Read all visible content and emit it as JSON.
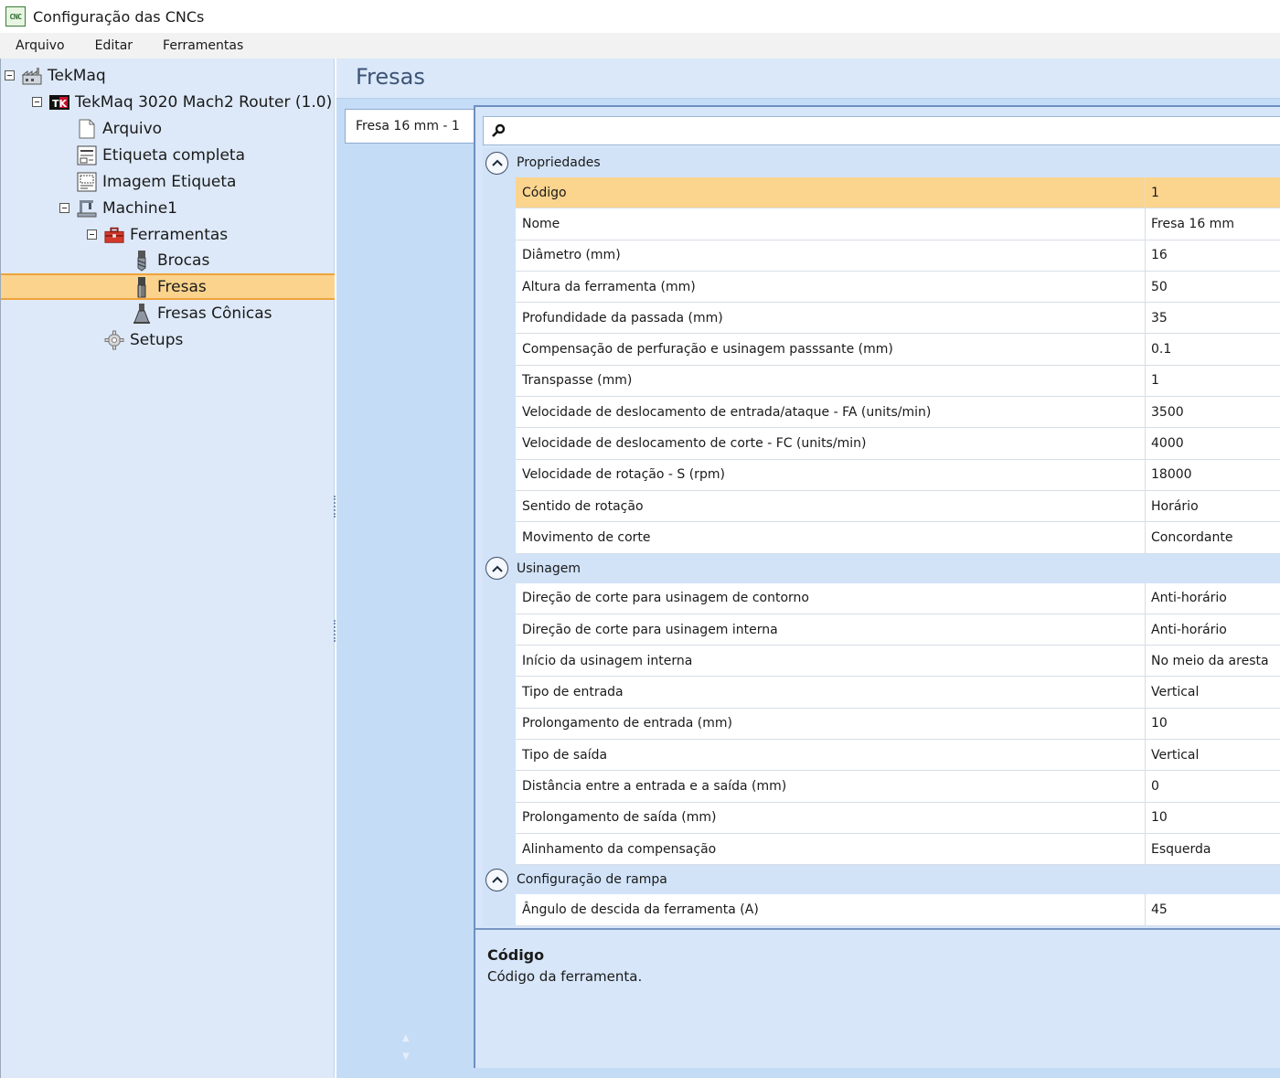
{
  "window": {
    "title": "Configuração das CNCs",
    "app_icon_text": "CNC"
  },
  "menu": [
    "Arquivo",
    "Editar",
    "Ferramentas"
  ],
  "tree": [
    {
      "label": "TekMaq",
      "level": 0,
      "toggle": true,
      "icon": "factory-icon"
    },
    {
      "label": "TekMaq 3020 Mach2 Router (1.0)",
      "level": 1,
      "toggle": true,
      "icon": "tk-logo-icon"
    },
    {
      "label": "Arquivo",
      "level": 2,
      "toggle": false,
      "icon": "file-icon"
    },
    {
      "label": "Etiqueta completa",
      "level": 2,
      "toggle": false,
      "icon": "label-icon"
    },
    {
      "label": "Imagem Etiqueta",
      "level": 2,
      "toggle": false,
      "icon": "label-image-icon"
    },
    {
      "label": "Machine1",
      "level": 2,
      "toggle": true,
      "icon": "machine-icon"
    },
    {
      "label": "Ferramentas",
      "level": 3,
      "toggle": true,
      "icon": "toolbox-icon"
    },
    {
      "label": "Brocas",
      "level": 4,
      "toggle": false,
      "icon": "drill-bit-icon"
    },
    {
      "label": "Fresas",
      "level": 4,
      "toggle": false,
      "icon": "end-mill-icon",
      "selected": true
    },
    {
      "label": "Fresas Cônicas",
      "level": 4,
      "toggle": false,
      "icon": "conical-mill-icon"
    },
    {
      "label": "Setups",
      "level": 3,
      "toggle": false,
      "icon": "gear-icon"
    }
  ],
  "pane": {
    "title": "Fresas",
    "tab": "Fresa 16 mm - 1"
  },
  "categories": [
    {
      "name": "Propriedades",
      "props": [
        {
          "name": "Código",
          "value": "1",
          "selected": true
        },
        {
          "name": "Nome",
          "value": "Fresa 16 mm"
        },
        {
          "name": "Diâmetro (mm)",
          "value": "16"
        },
        {
          "name": "Altura da ferramenta (mm)",
          "value": "50"
        },
        {
          "name": "Profundidade da passada (mm)",
          "value": "35"
        },
        {
          "name": "Compensação de perfuração e usinagem passsante (mm)",
          "value": "0.1"
        },
        {
          "name": "Transpasse (mm)",
          "value": "1"
        },
        {
          "name": "Velocidade de deslocamento de entrada/ataque - FA (units/min)",
          "value": "3500"
        },
        {
          "name": "Velocidade de deslocamento de corte - FC (units/min)",
          "value": "4000"
        },
        {
          "name": "Velocidade de rotação - S (rpm)",
          "value": "18000"
        },
        {
          "name": "Sentido de rotação",
          "value": "Horário"
        },
        {
          "name": "Movimento de corte",
          "value": "Concordante"
        }
      ]
    },
    {
      "name": "Usinagem",
      "props": [
        {
          "name": "Direção de corte para usinagem de contorno",
          "value": "Anti-horário"
        },
        {
          "name": "Direção de corte para usinagem interna",
          "value": "Anti-horário"
        },
        {
          "name": "Início da usinagem interna",
          "value": "No meio da aresta"
        },
        {
          "name": "Tipo de entrada",
          "value": "Vertical"
        },
        {
          "name": "Prolongamento de entrada (mm)",
          "value": "10"
        },
        {
          "name": "Tipo de saída",
          "value": "Vertical"
        },
        {
          "name": "Distância entre a entrada e a saída (mm)",
          "value": "0"
        },
        {
          "name": "Prolongamento de saída (mm)",
          "value": "10"
        },
        {
          "name": "Alinhamento da compensação",
          "value": "Esquerda"
        }
      ]
    },
    {
      "name": "Configuração de rampa",
      "props": [
        {
          "name": "Ângulo de descida da ferramenta (A)",
          "value": "45"
        }
      ]
    }
  ],
  "description": {
    "title": "Código",
    "text": "Código da ferramenta."
  }
}
